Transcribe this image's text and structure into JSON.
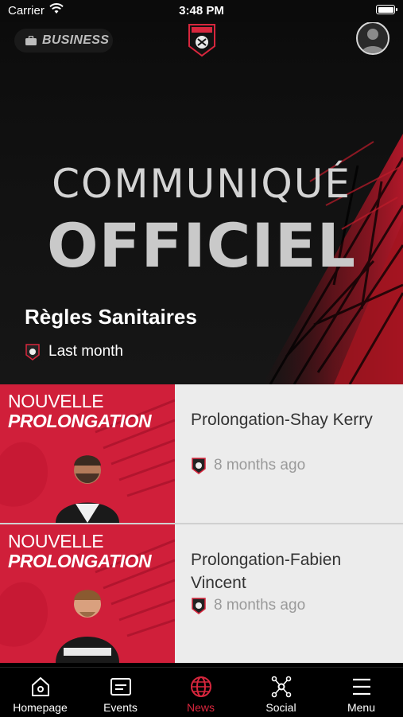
{
  "status_bar": {
    "carrier": "Carrier",
    "time": "3:48 PM"
  },
  "header": {
    "business_label": "BUSINESS"
  },
  "hero": {
    "title_line1": "COMMUNIQUÉ",
    "title_line2": "OFFICIEL",
    "headline": "Règles Sanitaires",
    "time": "Last month"
  },
  "news": [
    {
      "thumb_line1": "NOUVELLE",
      "thumb_line2": "PROLONGATION",
      "title": "Prolongation-Shay Kerry",
      "time": "8 months ago"
    },
    {
      "thumb_line1": "NOUVELLE",
      "thumb_line2": "PROLONGATION",
      "title": "Prolongation-Fabien Vincent",
      "time": "8 months ago"
    }
  ],
  "tabs": [
    {
      "label": "Homepage",
      "icon": "home-icon",
      "active": false
    },
    {
      "label": "Events",
      "icon": "calendar-icon",
      "active": false
    },
    {
      "label": "News",
      "icon": "globe-icon",
      "active": true
    },
    {
      "label": "Social",
      "icon": "network-icon",
      "active": false
    },
    {
      "label": "Menu",
      "icon": "menu-icon",
      "active": false
    }
  ],
  "colors": {
    "accent": "#d7263d",
    "thumb_red": "#d01f3a",
    "background": "#000000"
  }
}
